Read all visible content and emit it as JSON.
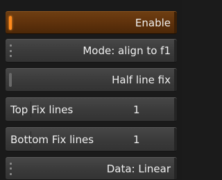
{
  "panel": {
    "enable": {
      "label": "Enable",
      "state": "on"
    },
    "mode": {
      "label": "Mode: align to f1"
    },
    "half_line_fix": {
      "label": "Half line fix",
      "state": "off"
    },
    "top_fix_lines": {
      "label": "Top Fix lines",
      "value": "1"
    },
    "bottom_fix_lines": {
      "label": "Bottom Fix lines",
      "value": "1"
    },
    "data": {
      "label": "Data: Linear"
    }
  },
  "colors": {
    "active_accent": "#ff8a1c",
    "active_background": "#5f320c",
    "button_background": "#3a3a3a",
    "panel_background": "#1a1a1a"
  }
}
